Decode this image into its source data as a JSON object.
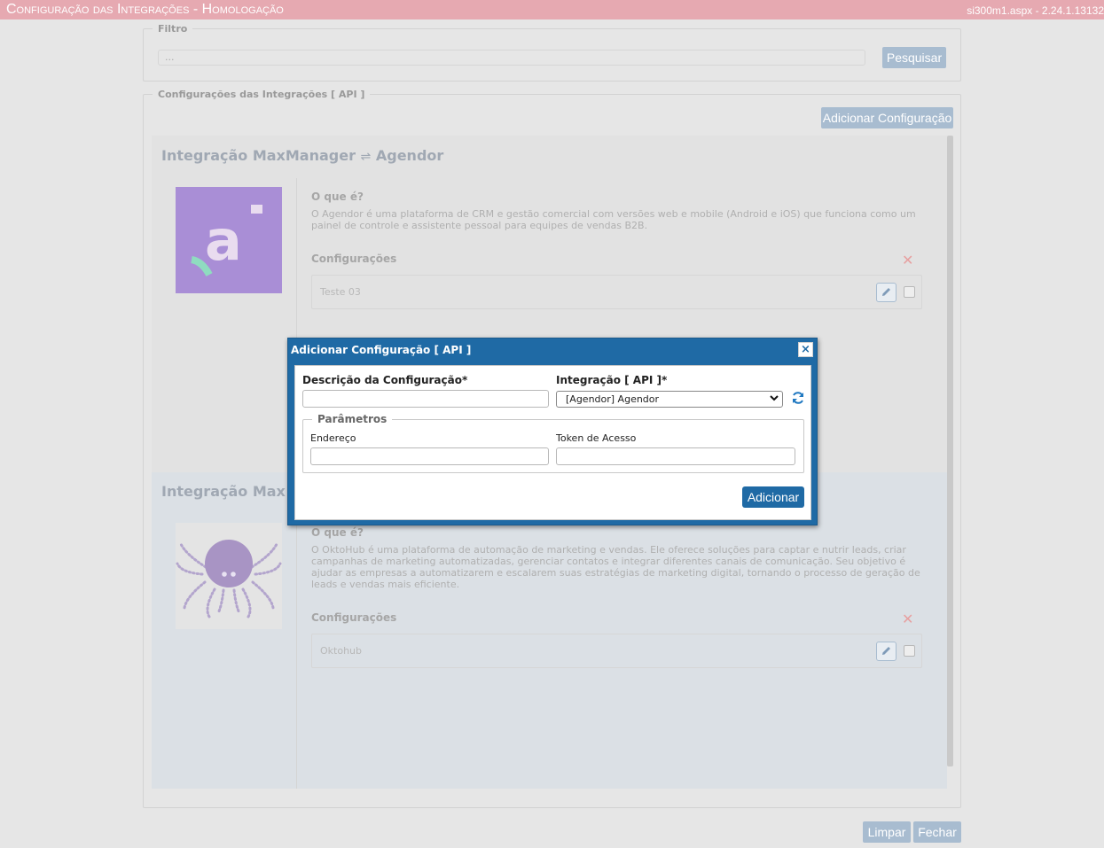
{
  "titlebar": {
    "title": "Configuração das Integrações  - Homologação",
    "version": "si300m1.aspx - 2.24.1.13132"
  },
  "filter": {
    "legend": "Filtro",
    "input_value": "...",
    "search_label": "Pesquisar"
  },
  "integrations": {
    "legend": "Configurações das Integrações [ API ]",
    "add_label": "Adicionar Configuração",
    "cards": [
      {
        "title": "Integração MaxManager",
        "arrow": "⇌",
        "partner": "Agendor",
        "what_title": "O que é?",
        "what_desc": "O Agendor é uma plataforma de CRM e gestão comercial com versões web e mobile (Android e iOS) que funciona como um painel de controle e assistente pessoal para equipes de vendas B2B.",
        "configs_title": "Configurações",
        "configs": [
          "Teste 03"
        ]
      },
      {
        "title": "Integração Max",
        "what_title": "O que é?",
        "what_desc": "O OktoHub é uma plataforma de automação de marketing e vendas. Ele oferece soluções para captar e nutrir leads, criar campanhas de marketing automatizadas, gerenciar contatos e integrar diferentes canais de comunicação. Seu objetivo é ajudar as empresas a automatizarem e escalarem suas estratégias de marketing digital, tornando o processo de geração de leads e vendas mais eficiente.",
        "configs_title": "Configurações",
        "configs": [
          "Oktohub"
        ]
      }
    ]
  },
  "footer": {
    "clear_label": "Limpar",
    "close_label": "Fechar"
  },
  "modal": {
    "title": "Adicionar Configuração [ API ]",
    "close_glyph": "×",
    "desc_label": "Descrição da Configuração*",
    "desc_value": "",
    "integ_label": "Integração [ API ]*",
    "integ_selected": "[Agendor] Agendor",
    "params_legend": "Parâmetros",
    "endereco_label": "Endereço",
    "endereco_value": "",
    "token_label": "Token de Acesso",
    "token_value": "",
    "submit_label": "Adicionar"
  },
  "icons": {
    "close": "close-icon",
    "edit": "pencil-icon",
    "refresh": "refresh-icon",
    "delete": "x-icon",
    "dropdown": "chevron-down-icon"
  },
  "colors": {
    "titlebar": "#e6a9b1",
    "primary": "#1f6aa5",
    "dim_button": "#a8bcd0",
    "agendor_logo_bg": "#a98ed6",
    "agendor_accent": "#8fdcc0",
    "oktohub_logo": "#a894c4"
  }
}
